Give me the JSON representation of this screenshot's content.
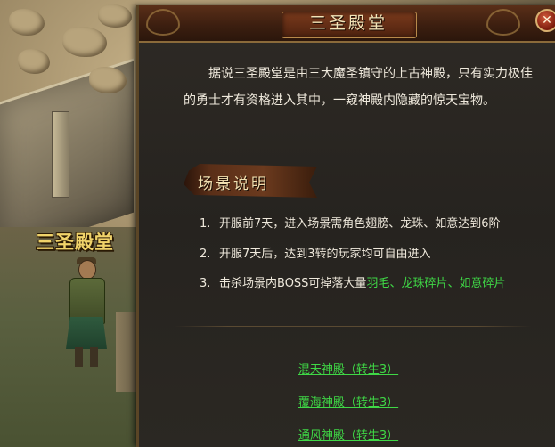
{
  "scene": {
    "label": "三圣殿堂"
  },
  "panel": {
    "title": "三圣殿堂",
    "intro": "据说三圣殿堂是由三大魔圣镇守的上古神殿，只有实力极佳的勇士才有资格进入其中，一窥神殿内隐藏的惊天宝物。",
    "section_title": "场景说明",
    "rules": [
      {
        "num": "1.",
        "text": "开服前7天，进入场景需角色翅膀、龙珠、如意达到6阶"
      },
      {
        "num": "2.",
        "text": "开服7天后，达到3转的玩家均可自由进入"
      },
      {
        "num": "3.",
        "text_prefix": "击杀场景内BOSS可掉落大量",
        "text_highlight": "羽毛、龙珠碎片、如意碎片"
      }
    ],
    "links": [
      {
        "label": "混天神殿（转生3）"
      },
      {
        "label": "覆海神殿（转生3）"
      },
      {
        "label": "通风神殿（转生3）"
      }
    ],
    "close_icon": "close-icon"
  },
  "colors": {
    "highlight_green": "#3fd846",
    "title_text": "#f3e4b8",
    "body_text": "#efe9dc"
  }
}
